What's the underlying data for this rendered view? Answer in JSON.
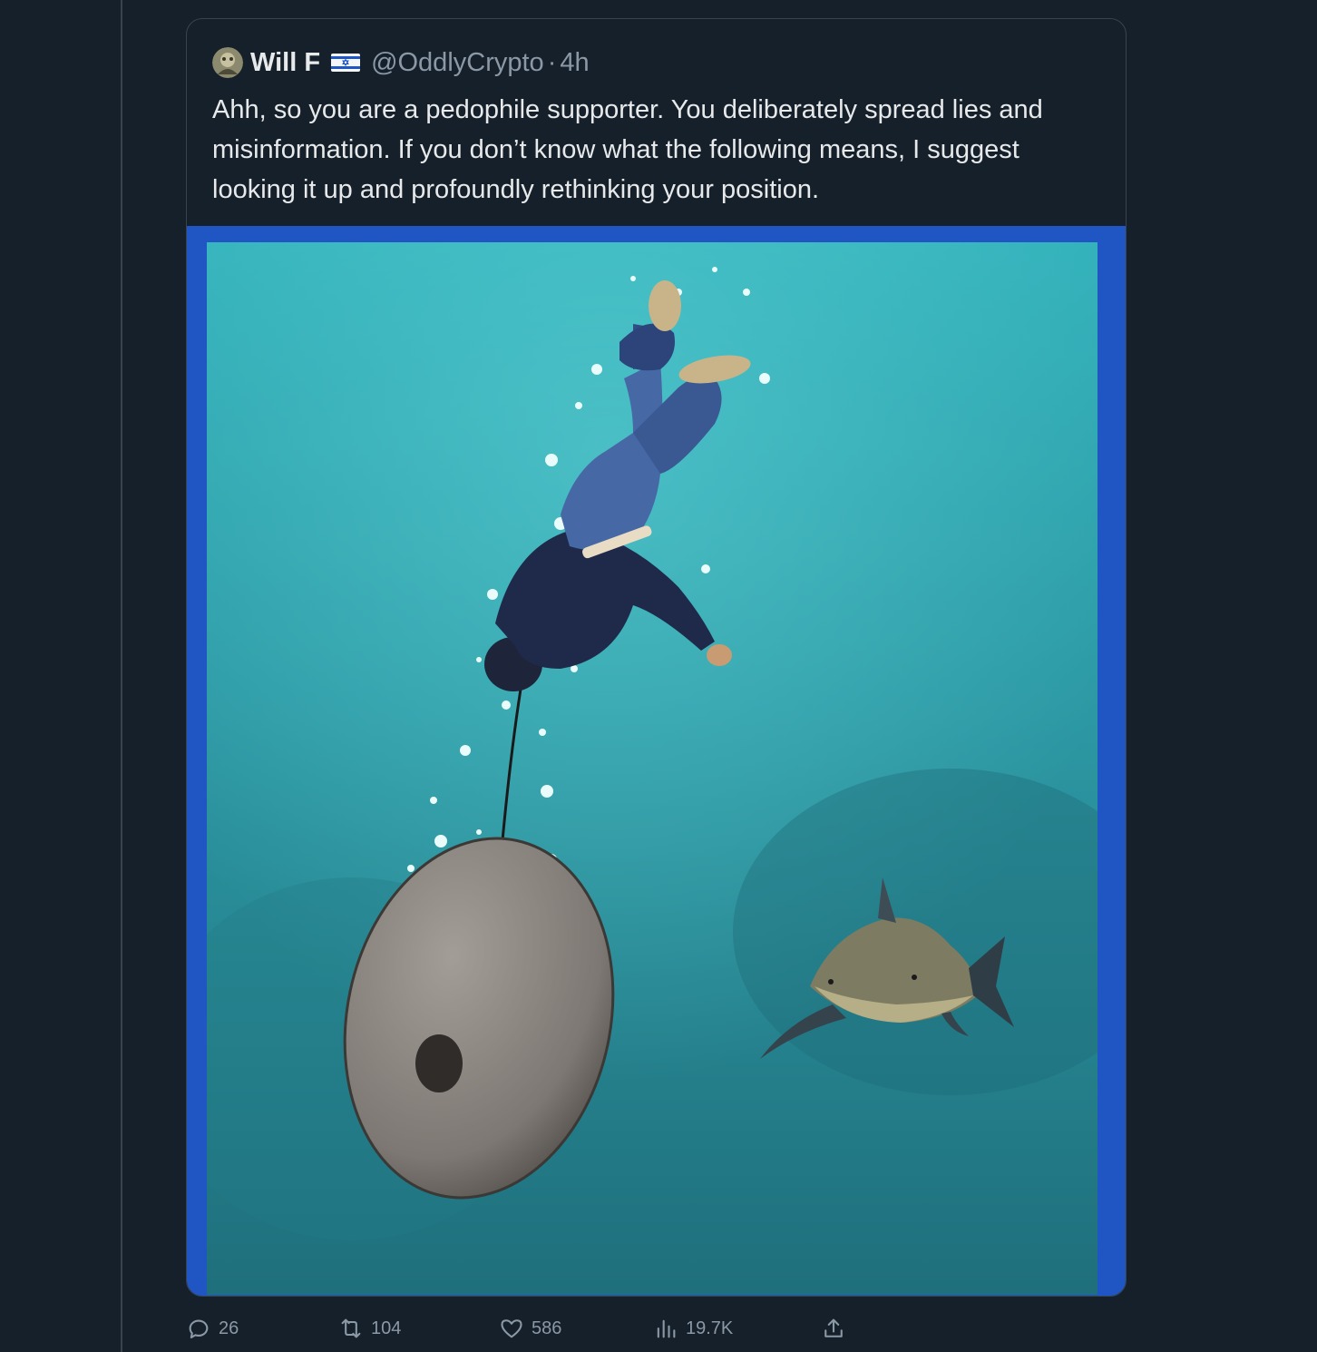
{
  "quoted_tweet": {
    "author": {
      "display_name": "Will F",
      "handle": "@OddlyCrypto",
      "separator": "·",
      "time": "4h"
    },
    "text": "Ahh, so you are a pedophile supporter. You deliberately spread lies and misinformation. If you don’t know what the following means, I suggest looking it up and profoundly rethinking your position.",
    "media": {
      "frame_color": "#1f56c4",
      "dominant_color": "#2a8a95"
    }
  },
  "actions": {
    "replies": "26",
    "reposts": "104",
    "likes": "586",
    "views": "19.7K"
  },
  "icons": {
    "avatar": "avatar-image",
    "flag": "israel-flag-icon",
    "reply": "reply-icon",
    "repost": "repost-icon",
    "like": "heart-icon",
    "views": "views-icon",
    "share": "share-icon"
  },
  "colors": {
    "background": "#15202b",
    "text_primary": "#e7e9ea",
    "text_secondary": "#8b98a5",
    "border": "#38444d"
  }
}
